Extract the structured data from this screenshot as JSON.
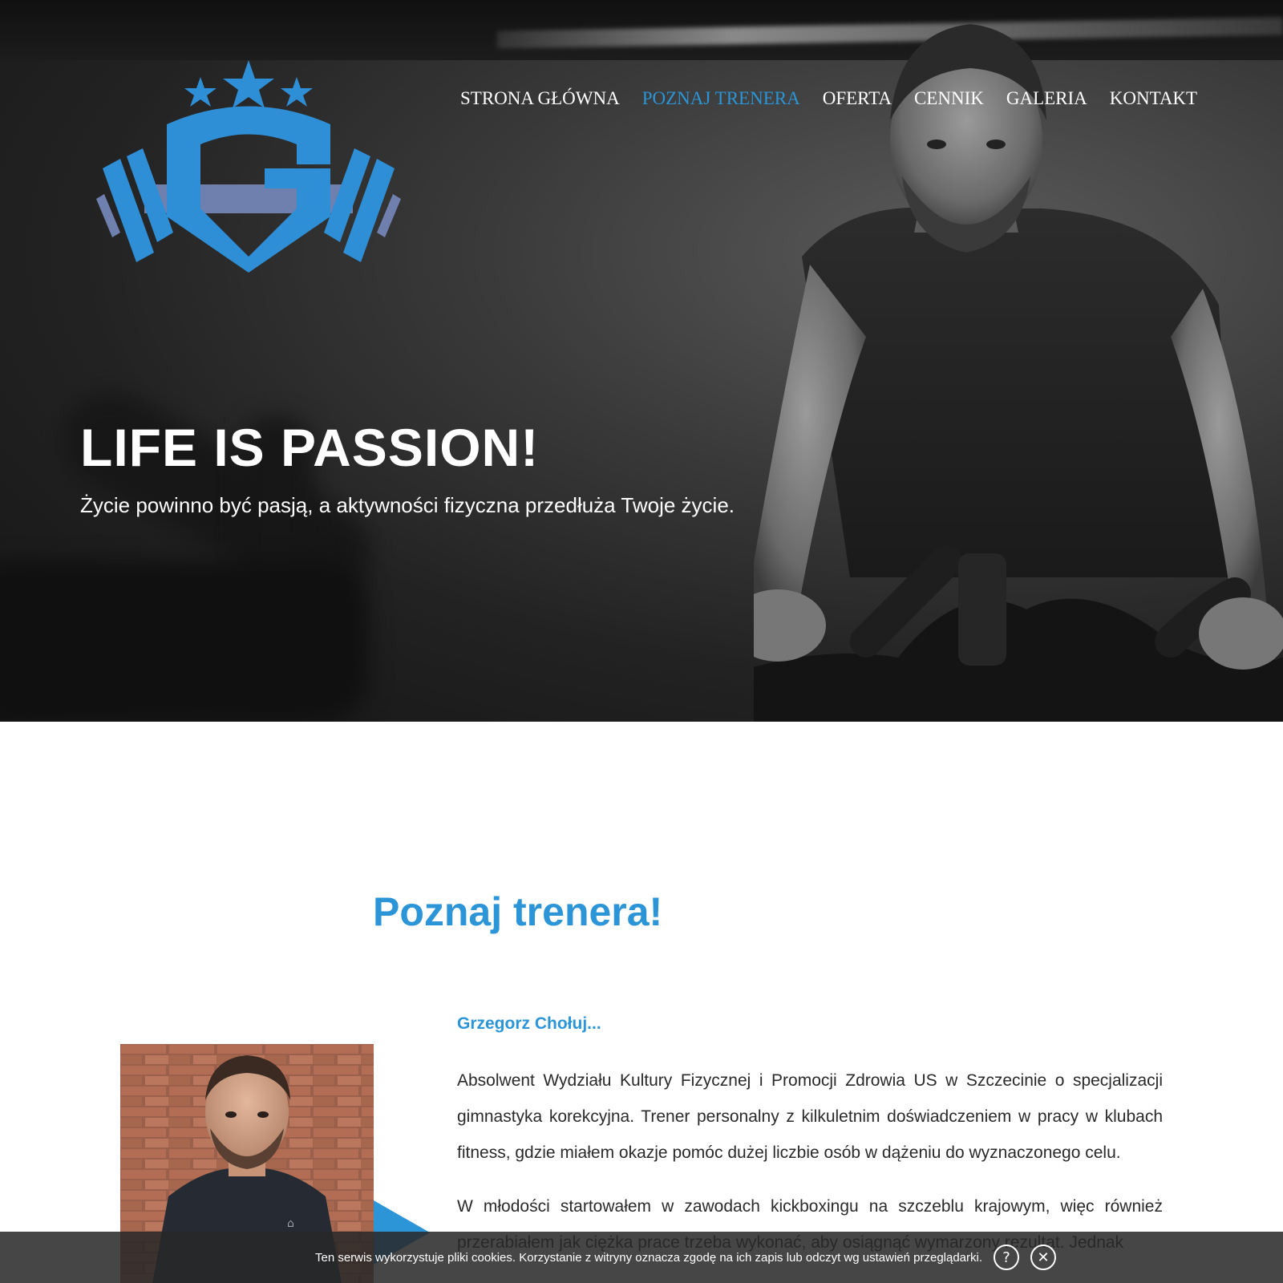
{
  "nav": {
    "items": [
      {
        "label": "STRONA GŁÓWNA",
        "active": false
      },
      {
        "label": "POZNAJ TRENERA",
        "active": true
      },
      {
        "label": "OFERTA",
        "active": false
      },
      {
        "label": "CENNIK",
        "active": false
      },
      {
        "label": "GALERIA",
        "active": false
      },
      {
        "label": "KONTAKT",
        "active": false
      }
    ]
  },
  "hero": {
    "title": "LIFE IS PASSION!",
    "subtitle": "Życie powinno być pasją, a aktywności fizyczna przedłuża Twoje życie."
  },
  "about": {
    "title": "Poznaj trenera!",
    "name": "Grzegorz Chołuj...",
    "paragraphs": [
      "Absolwent Wydziału Kultury Fizycznej i Promocji Zdrowia US w Szczecinie o specjalizacji gimnastyka korekcyjna. Trener personalny z kilkuletnim doświadczeniem w pracy w klubach fitness, gdzie miałem okazje pomóc dużej liczbie osób w dążeniu do wyznaczonego celu.",
      "W młodości startowałem w zawodach kickboxingu na szczeblu krajowym, więc również przerabiałem jak ciężka prace trzeba wykonać, aby osiągnąć wymarzony rezultat. Jednak"
    ]
  },
  "cookie": {
    "text": "Ten serwis wykorzystuje pliki cookies. Korzystanie z witryny oznacza zgodę na ich zapis lub odczyt wg ustawień przeglądarki.",
    "help_icon": "?",
    "close_icon": "✕"
  },
  "colors": {
    "accent": "#2b95d8",
    "logo_blue": "#2f8fd6",
    "logo_slate": "#6f7fae",
    "text": "#2a2a2a"
  }
}
